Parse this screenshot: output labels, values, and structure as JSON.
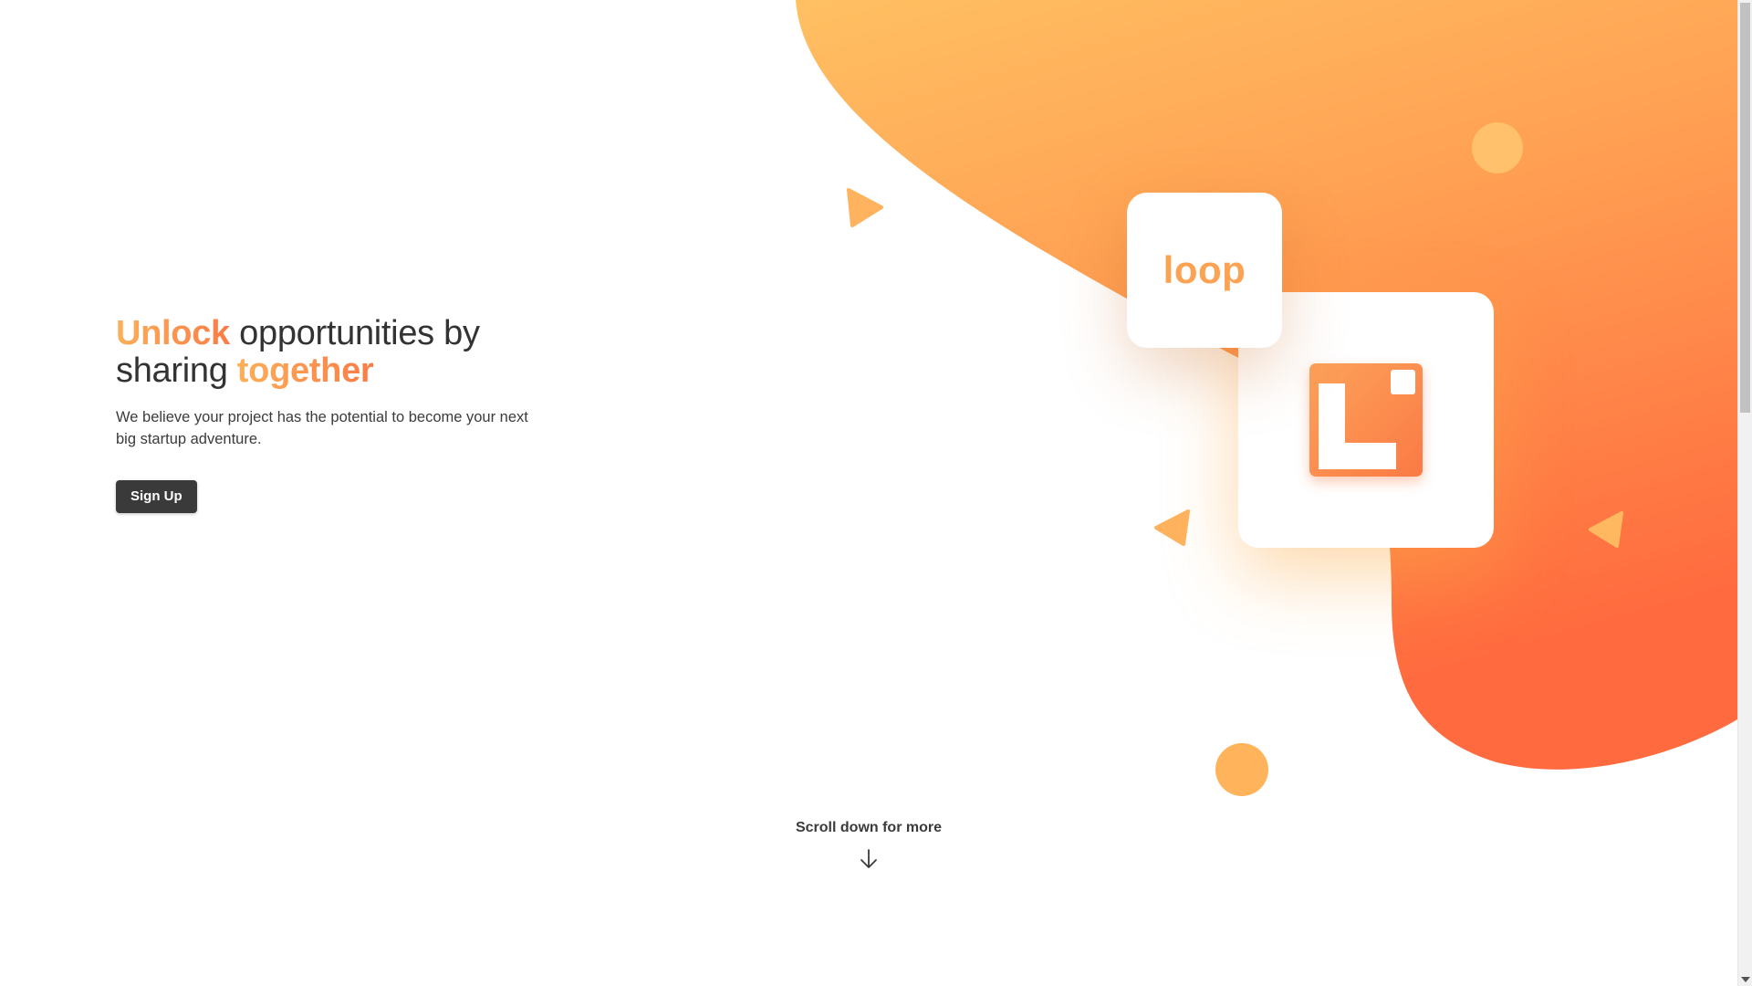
{
  "hero": {
    "headline_accent_1": "Unlock",
    "headline_part_1": " opportunities by",
    "headline_part_2": "sharing ",
    "headline_accent_2": "together",
    "subtext": "We believe your project has the potential to become your next big startup adventure.",
    "signup_label": "Sign Up"
  },
  "illustration": {
    "loop_card_text": "loop",
    "logo_icon": "loop-logo-icon",
    "shape_icons": [
      "triangle-icon",
      "circle-icon"
    ]
  },
  "scroll_hint": {
    "label": "Scroll down for more",
    "icon": "arrow-down-icon"
  },
  "colors": {
    "accent_start": "#fdb05a",
    "accent_end": "#fb7b45",
    "blob_top": "#ffbd63",
    "blob_bottom": "#ff6a3d",
    "button_bg": "#3a3a3a",
    "text_dark": "#333333"
  }
}
